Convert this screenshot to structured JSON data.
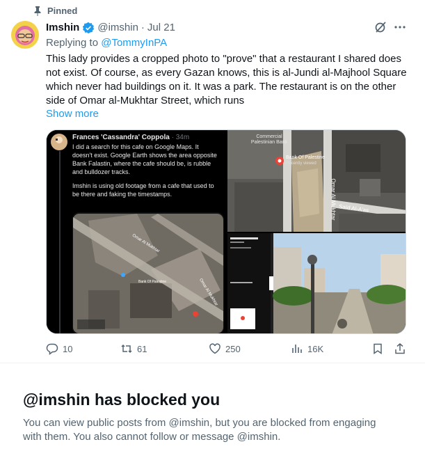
{
  "pinned": {
    "label": "Pinned",
    "icon": "pin-icon"
  },
  "author": {
    "name": "Imshin",
    "handle": "@imshin",
    "separator": "·",
    "date": "Jul 21",
    "verified_color": "#1d9bf0"
  },
  "reply": {
    "prefix": "Replying to",
    "target": "@TommyInPA"
  },
  "body": {
    "text": "This lady provides a cropped photo to \"prove\" that a restaurant I shared does not exist. Of course, as every Gazan knows, this is al-Jundi al-Majhool Square which never had buildings on it. It was a park. The restaurant is on the other side of Omar al-Mukhtar Street, which runs",
    "show_more": "Show more"
  },
  "media": {
    "inner_post": {
      "author": "Frances 'Cassandra' Coppola",
      "time": "· 34m",
      "text1": "I did a search for this cafe on Google Maps. It doesn't exist. Google Earth shows the area opposite Bank Falastin, where the cafe should be, is rubble and bulldozer tracks.",
      "text2": "Imshin is using old footage from a cafe that used to be there and faking the timestamps.",
      "map_labels": [
        "Omar Al Mukhtar",
        "Bank Of Palestine",
        "Omar Al Mukhtar"
      ]
    },
    "map_top": {
      "labels": [
        "Commercial Palestinian Bank",
        "Bank Of Palestine",
        "Recently viewed",
        "Omar Al Mukhtar",
        "Saïd Al-A'as"
      ]
    }
  },
  "actions": {
    "replies": "10",
    "reposts": "61",
    "likes": "250",
    "views": "16K"
  },
  "blocked": {
    "title": "@imshin has blocked you",
    "description": "You can view public posts from @imshin, but you are blocked from engaging with them. You also cannot follow or message @imshin."
  }
}
